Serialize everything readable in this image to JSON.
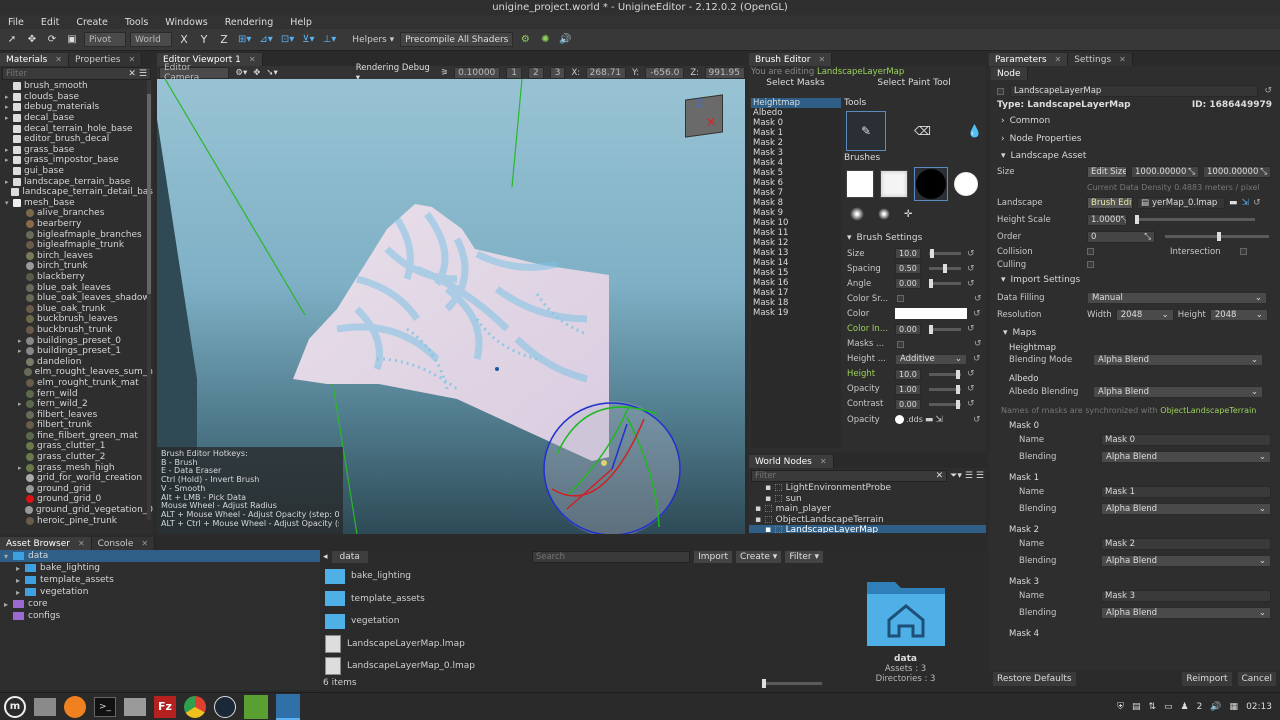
{
  "window": {
    "title": "unigine_project.world * - UnigineEditor - 2.12.0.2 (OpenGL)"
  },
  "menu": [
    "File",
    "Edit",
    "Create",
    "Tools",
    "Windows",
    "Rendering",
    "Help"
  ],
  "toolbar": {
    "pivot": "Pivot",
    "world": "World",
    "x": "X",
    "y": "Y",
    "z": "Z",
    "helpers": "Helpers",
    "precompile": "Precompile All Shaders"
  },
  "materials": {
    "tabs": [
      "Materials",
      "Properties"
    ],
    "filter_placeholder": "Filter",
    "items": [
      {
        "label": "brush_smooth",
        "indent": 1,
        "icon": "#ddd",
        "arrow": ""
      },
      {
        "label": "clouds_base",
        "indent": 1,
        "icon": "#ddd",
        "arrow": "▸"
      },
      {
        "label": "debug_materials",
        "indent": 1,
        "icon": "#ddd",
        "arrow": "▸"
      },
      {
        "label": "decal_base",
        "indent": 1,
        "icon": "#ddd",
        "arrow": "▸"
      },
      {
        "label": "decal_terrain_hole_base",
        "indent": 1,
        "icon": "#ddd",
        "arrow": ""
      },
      {
        "label": "editor_brush_decal",
        "indent": 1,
        "icon": "#ddd",
        "arrow": ""
      },
      {
        "label": "grass_base",
        "indent": 1,
        "icon": "#ddd",
        "arrow": "▸"
      },
      {
        "label": "grass_impostor_base",
        "indent": 1,
        "icon": "#ddd",
        "arrow": "▸"
      },
      {
        "label": "gui_base",
        "indent": 1,
        "icon": "#ddd",
        "arrow": ""
      },
      {
        "label": "landscape_terrain_base",
        "indent": 1,
        "icon": "#ddd",
        "arrow": "▸"
      },
      {
        "label": "landscape_terrain_detail_bas",
        "indent": 1,
        "icon": "#ddd",
        "arrow": ""
      },
      {
        "label": "mesh_base",
        "indent": 1,
        "icon": "#eee",
        "arrow": "▾"
      },
      {
        "label": "alive_branches",
        "indent": 2,
        "icon": "#7a6a4a",
        "arrow": ""
      },
      {
        "label": "bearberry",
        "indent": 2,
        "icon": "#8a6a4a",
        "arrow": ""
      },
      {
        "label": "bigleafmaple_branches",
        "indent": 2,
        "icon": "#6a6a5a",
        "arrow": ""
      },
      {
        "label": "bigleafmaple_trunk",
        "indent": 2,
        "icon": "#6a5a4a",
        "arrow": ""
      },
      {
        "label": "birch_leaves",
        "indent": 2,
        "icon": "#7a7a5a",
        "arrow": ""
      },
      {
        "label": "birch_trunk",
        "indent": 2,
        "icon": "#9a9a9a",
        "arrow": ""
      },
      {
        "label": "blackberry",
        "indent": 2,
        "icon": "#5a5a4a",
        "arrow": ""
      },
      {
        "label": "blue_oak_leaves",
        "indent": 2,
        "icon": "#6a6a5a",
        "arrow": ""
      },
      {
        "label": "blue_oak_leaves_shadow",
        "indent": 2,
        "icon": "#6a6a5a",
        "arrow": ""
      },
      {
        "label": "blue_oak_trunk",
        "indent": 2,
        "icon": "#6a5a4a",
        "arrow": ""
      },
      {
        "label": "buckbrush_leaves",
        "indent": 2,
        "icon": "#6a6a4a",
        "arrow": ""
      },
      {
        "label": "buckbrush_trunk",
        "indent": 2,
        "icon": "#6a5a4a",
        "arrow": ""
      },
      {
        "label": "buildings_preset_0",
        "indent": 2,
        "icon": "#888",
        "arrow": "▸"
      },
      {
        "label": "buildings_preset_1",
        "indent": 2,
        "icon": "#888",
        "arrow": "▸"
      },
      {
        "label": "dandelion",
        "indent": 2,
        "icon": "#7a7a6a",
        "arrow": ""
      },
      {
        "label": "elm_rought_leaves_sum_n",
        "indent": 2,
        "icon": "#6a6a5a",
        "arrow": ""
      },
      {
        "label": "elm_rought_trunk_mat",
        "indent": 2,
        "icon": "#6a5a4a",
        "arrow": ""
      },
      {
        "label": "fern_wild",
        "indent": 2,
        "icon": "#5a6a4a",
        "arrow": ""
      },
      {
        "label": "fern_wild_2",
        "indent": 2,
        "icon": "#5a6a4a",
        "arrow": "▸"
      },
      {
        "label": "filbert_leaves",
        "indent": 2,
        "icon": "#6a6a5a",
        "arrow": ""
      },
      {
        "label": "filbert_trunk",
        "indent": 2,
        "icon": "#6a5a4a",
        "arrow": ""
      },
      {
        "label": "fine_filbert_green_mat",
        "indent": 2,
        "icon": "#5a6a4a",
        "arrow": ""
      },
      {
        "label": "grass_clutter_1",
        "indent": 2,
        "icon": "#6a7a4a",
        "arrow": ""
      },
      {
        "label": "grass_clutter_2",
        "indent": 2,
        "icon": "#6a7a4a",
        "arrow": ""
      },
      {
        "label": "grass_mesh_high",
        "indent": 2,
        "icon": "#6a7a4a",
        "arrow": "▸"
      },
      {
        "label": "grid_for_world_creation",
        "indent": 2,
        "icon": "#aaa",
        "arrow": ""
      },
      {
        "label": "ground_grid",
        "indent": 2,
        "icon": "#999",
        "arrow": ""
      },
      {
        "label": "ground_grid_0",
        "indent": 2,
        "icon": "#dd1111",
        "arrow": ""
      },
      {
        "label": "ground_grid_vegetation_0",
        "indent": 2,
        "icon": "#999",
        "arrow": ""
      },
      {
        "label": "heroic_pine_trunk",
        "indent": 2,
        "icon": "#6a5a4a",
        "arrow": ""
      }
    ]
  },
  "viewport": {
    "tab": "Editor Viewport 1",
    "camera": "Editor Camera",
    "rendering_debug": "Rendering Debug",
    "speed": "0.10000",
    "speed_steps": [
      "1",
      "2",
      "3"
    ],
    "coords": {
      "x_label": "X:",
      "x": "268.71",
      "y_label": "Y:",
      "y": "-656.0",
      "z_label": "Z:",
      "z": "991.95"
    },
    "hotkeys": [
      "Brush Editor Hotkeys:",
      "B - Brush",
      "E - Data Eraser",
      "Ctrl (Hold) - Invert Brush",
      "V - Smooth",
      "Alt + LMB - Pick Data",
      "Mouse Wheel - Adjust Radius",
      "ALT + Mouse Wheel - Adjust Opacity (step: 0",
      "ALT + Ctrl + Mouse Wheel - Adjust Opacity (s"
    ]
  },
  "brush_editor": {
    "tab": "Brush Editor",
    "editing_prefix": "You are editing",
    "editing_target": "LandscapeLayerMap",
    "select_masks": "Select Masks",
    "select_paint_tool": "Select Paint Tool",
    "masks": [
      "Heightmap",
      "Albedo",
      "Mask 0",
      "Mask 1",
      "Mask 2",
      "Mask 3",
      "Mask 4",
      "Mask 5",
      "Mask 6",
      "Mask 7",
      "Mask 8",
      "Mask 9",
      "Mask 10",
      "Mask 11",
      "Mask 12",
      "Mask 13",
      "Mask 14",
      "Mask 15",
      "Mask 16",
      "Mask 17",
      "Mask 18",
      "Mask 19"
    ],
    "tools_label": "Tools",
    "brushes_label": "Brushes",
    "settings_label": "Brush Settings",
    "settings": [
      {
        "label": "Size",
        "value": "10.0",
        "kind": "slider",
        "pos": 0.05,
        "color": "#c9c9c9"
      },
      {
        "label": "Spacing",
        "value": "0.50",
        "kind": "slider",
        "pos": 0.5,
        "color": "#c9c9c9"
      },
      {
        "label": "Angle",
        "value": "0.00",
        "kind": "slider",
        "pos": 0.0,
        "color": "#c9c9c9"
      },
      {
        "label": "Color Sr...",
        "value": "",
        "kind": "check",
        "color": "#c9c9c9"
      },
      {
        "label": "Color",
        "value": "",
        "kind": "color",
        "color": "#c9c9c9"
      },
      {
        "label": "Color In...",
        "value": "0.00",
        "kind": "slider",
        "pos": 0.0,
        "color": "#9bd35a"
      },
      {
        "label": "Masks ...",
        "value": "",
        "kind": "check",
        "color": "#c9c9c9"
      },
      {
        "label": "Height ...",
        "value": "Additive",
        "kind": "dropdown",
        "color": "#c9c9c9"
      },
      {
        "label": "Height",
        "value": "10.0",
        "kind": "slider",
        "pos": 0.95,
        "color": "#9bd35a"
      },
      {
        "label": "Opacity",
        "value": "1.00",
        "kind": "slider",
        "pos": 0.95,
        "color": "#c9c9c9"
      },
      {
        "label": "Contrast",
        "value": "0.00",
        "kind": "slider",
        "pos": 0.95,
        "color": "#c9c9c9"
      },
      {
        "label": "Opacity",
        "value": ".dds",
        "kind": "file",
        "color": "#c9c9c9"
      }
    ]
  },
  "world_nodes": {
    "tab": "World Nodes",
    "filter_placeholder": "Filter",
    "items": [
      {
        "label": "LightEnvironmentProbe",
        "indent": 2,
        "selected": false
      },
      {
        "label": "sun",
        "indent": 2,
        "selected": false
      },
      {
        "label": "main_player",
        "indent": 1,
        "selected": false
      },
      {
        "label": "ObjectLandscapeTerrain",
        "indent": 1,
        "selected": false
      },
      {
        "label": "LandscapeLayerMap",
        "indent": 2,
        "selected": true
      }
    ]
  },
  "parameters": {
    "tabs": [
      "Parameters",
      "Settings"
    ],
    "subtab": "Node",
    "name": "LandscapeLayerMap",
    "type_label": "Type: LandscapeLayerMap",
    "id_label": "ID: 1686449979",
    "common": "Common",
    "node_properties": "Node Properties",
    "landscape_asset": "Landscape Asset",
    "size_label": "Size",
    "edit_size": "Edit Size",
    "size_x": "1000.00000",
    "size_y": "1000.00000",
    "density": "Current Data Density 0.4883 meters / pixel",
    "landscape_label": "Landscape",
    "brush_edit": "Brush Edit",
    "lmap_file": "yerMap_0.lmap",
    "height_scale_label": "Height Scale",
    "height_scale": "1.0000",
    "order_label": "Order",
    "order": "0",
    "collision_label": "Collision",
    "intersection_label": "Intersection",
    "culling_label": "Culling",
    "import_settings": "Import Settings",
    "data_filling_label": "Data Filling",
    "data_filling": "Manual",
    "resolution_label": "Resolution",
    "width_label": "Width",
    "width": "2048",
    "height_label": "Height",
    "height": "2048",
    "maps": "Maps",
    "heightmap": "Heightmap",
    "blending_mode_label": "Blending Mode",
    "blending_mode": "Alpha Blend",
    "albedo": "Albedo",
    "albedo_blending_label": "Albedo Blending",
    "albedo_blending": "Alpha Blend",
    "sync_note_prefix": "Names of masks are synchronized with",
    "sync_note_link": "ObjectLandscapeTerrain",
    "mask_entries": [
      {
        "title": "Mask 0",
        "name_label": "Name",
        "name": "Mask 0",
        "blending_label": "Blending",
        "blending": "Alpha Blend"
      },
      {
        "title": "Mask 1",
        "name_label": "Name",
        "name": "Mask 1",
        "blending_label": "Blending",
        "blending": "Alpha Blend"
      },
      {
        "title": "Mask 2",
        "name_label": "Name",
        "name": "Mask 2",
        "blending_label": "Blending",
        "blending": "Alpha Blend"
      },
      {
        "title": "Mask 3",
        "name_label": "Name",
        "name": "Mask 3",
        "blending_label": "Blending",
        "blending": "Alpha Blend"
      }
    ],
    "mask4_title": "Mask 4",
    "restore_defaults": "Restore Defaults",
    "reimport": "Reimport",
    "cancel": "Cancel"
  },
  "asset_browser": {
    "tabs": [
      "Asset Browser",
      "Console"
    ],
    "tree": [
      {
        "label": "data",
        "indent": 0,
        "arrow": "▾",
        "selected": true,
        "color": "#3ea0e0"
      },
      {
        "label": "bake_lighting",
        "indent": 1,
        "arrow": "▸",
        "selected": false,
        "color": "#3ea0e0"
      },
      {
        "label": "template_assets",
        "indent": 1,
        "arrow": "▸",
        "selected": false,
        "color": "#3ea0e0"
      },
      {
        "label": "vegetation",
        "indent": 1,
        "arrow": "▸",
        "selected": false,
        "color": "#3ea0e0"
      },
      {
        "label": "core",
        "indent": 0,
        "arrow": "▸",
        "selected": false,
        "color": "#9a6ad0"
      },
      {
        "label": "configs",
        "indent": 0,
        "arrow": "",
        "selected": false,
        "color": "#9a6ad0"
      }
    ],
    "breadcrumb": "data",
    "search_placeholder": "Search",
    "import": "Import",
    "create": "Create",
    "filter": "Filter",
    "files": [
      {
        "label": "bake_lighting",
        "kind": "folder"
      },
      {
        "label": "template_assets",
        "kind": "folder"
      },
      {
        "label": "vegetation",
        "kind": "folder"
      },
      {
        "label": "LandscapeLayerMap.lmap",
        "kind": "file"
      },
      {
        "label": "LandscapeLayerMap_0.lmap",
        "kind": "file"
      }
    ],
    "count": "6 items",
    "preview_name": "data",
    "preview_assets": "Assets : 3",
    "preview_dirs": "Directories : 3"
  },
  "taskbar": {
    "apps": [
      "mint-menu",
      "files",
      "firefox",
      "terminal",
      "file-manager",
      "filezilla",
      "chrome",
      "steam",
      "unigine-browser",
      "unigine-editor"
    ],
    "tray_num": "2",
    "time": "02:13"
  },
  "colors": {
    "accent": "#3ea0e0",
    "green_label": "#9bd35a",
    "selection": "#2f5f86"
  }
}
